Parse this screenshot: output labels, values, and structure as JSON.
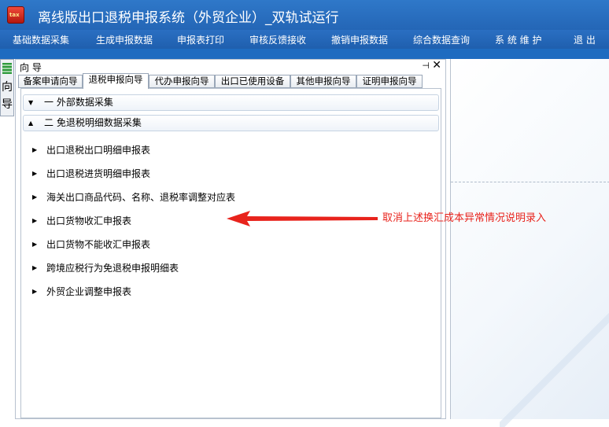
{
  "window": {
    "title": "离线版出口退税申报系统（外贸企业）_双轨试运行",
    "icon": "tax-app-icon",
    "icon_text": "tax"
  },
  "menu": [
    "基础数据采集",
    "生成申报数据",
    "申报表打印",
    "审核反馈接收",
    "撤销申报数据",
    "综合数据查询",
    "系 统 维 护",
    "退 出"
  ],
  "side_tab": {
    "label": "向导"
  },
  "panel": {
    "title": "向 导",
    "tabs": [
      "备案申请向导",
      "退税申报向导",
      "代办申报向导",
      "出口已使用设备",
      "其他申报向导",
      "证明申报向导"
    ],
    "active_tab": 1,
    "sections": [
      {
        "label": "一  外部数据采集",
        "expanded": false
      },
      {
        "label": "二  免退税明细数据采集",
        "expanded": true
      }
    ],
    "items": [
      "出口退税出口明细申报表",
      "出口退税进货明细申报表",
      "海关出口商品代码、名称、退税率调整对应表",
      "出口货物收汇申报表",
      "出口货物不能收汇申报表",
      "跨境应税行为免退税申报明细表",
      "外贸企业调整申报表"
    ]
  },
  "annotation": {
    "text": "取消上述换汇成本异常情况说明录入",
    "color": "#e8231c"
  },
  "colors": {
    "titlebar": "#2a6fc2",
    "menubar": "#1f5fae",
    "accent": "#1e6bc0"
  }
}
